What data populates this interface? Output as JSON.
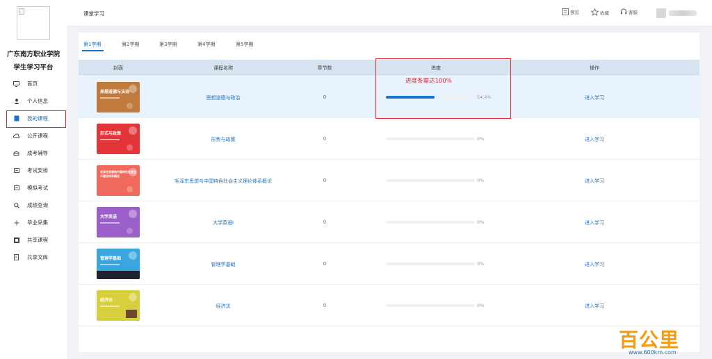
{
  "sidebar": {
    "school_line1": "广东南方职业学院",
    "school_line2": "学生学习平台",
    "items": [
      {
        "label": "首页",
        "icon": "monitor-icon"
      },
      {
        "label": "个人信息",
        "icon": "user-icon"
      },
      {
        "label": "我的课程",
        "icon": "book-icon",
        "active": true
      },
      {
        "label": "公开课程",
        "icon": "cloud-icon"
      },
      {
        "label": "成考辅导",
        "icon": "graduation-icon"
      },
      {
        "label": "考试安排",
        "icon": "list-icon"
      },
      {
        "label": "模拟考试",
        "icon": "list-icon"
      },
      {
        "label": "成绩查询",
        "icon": "search-icon"
      },
      {
        "label": "毕业采集",
        "icon": "plus-icon"
      },
      {
        "label": "共享课程",
        "icon": "share-icon"
      },
      {
        "label": "共享文库",
        "icon": "document-icon"
      }
    ]
  },
  "header": {
    "title": "课堂学习",
    "actions": [
      {
        "label": "预览",
        "icon": "preview-icon"
      },
      {
        "label": "收藏",
        "icon": "star-icon"
      },
      {
        "label": "客服",
        "icon": "headset-icon"
      }
    ]
  },
  "tabs": [
    "第1学期",
    "第2学期",
    "第3学期",
    "第4学期",
    "第5学期"
  ],
  "table": {
    "headers": [
      "封面",
      "课程名称",
      "章节数",
      "进度",
      "操作"
    ],
    "rows": [
      {
        "cover_title": "思想道德与法治",
        "name": "思想道德与政治",
        "chapters": "0",
        "progress": 0.544,
        "progress_text": "54.4%",
        "action": "进入学习"
      },
      {
        "cover_title": "形式与政策",
        "name": "形势与政策",
        "chapters": "0",
        "progress": 0,
        "progress_text": "0%",
        "action": "进入学习"
      },
      {
        "cover_title": "毛泽东思想和中国特色社会主义理论体系概论",
        "name": "毛泽东思想与中国特色社会主义理论体系概论",
        "chapters": "0",
        "progress": 0,
        "progress_text": "0%",
        "action": "进入学习"
      },
      {
        "cover_title": "大学英语",
        "name": "大学英语Ⅰ",
        "chapters": "0",
        "progress": 0,
        "progress_text": "0%",
        "action": "进入学习"
      },
      {
        "cover_title": "管理学基础",
        "name": "管理学基础",
        "chapters": "0",
        "progress": 0,
        "progress_text": "0%",
        "action": "进入学习"
      },
      {
        "cover_title": "经济法",
        "name": "经济法",
        "chapters": "0",
        "progress": 0,
        "progress_text": "0%",
        "action": "进入学习"
      }
    ]
  },
  "annotation": {
    "text": "进度条需达100%",
    "color": "#e3262b"
  },
  "watermark": {
    "logo": "百公里",
    "url": "www.600km.com"
  },
  "colors": {
    "accent": "#1a73c9",
    "annotation": "#e3262b",
    "table_header_bg": "#d6e3f1",
    "highlight_row": "#e9f3fd"
  }
}
